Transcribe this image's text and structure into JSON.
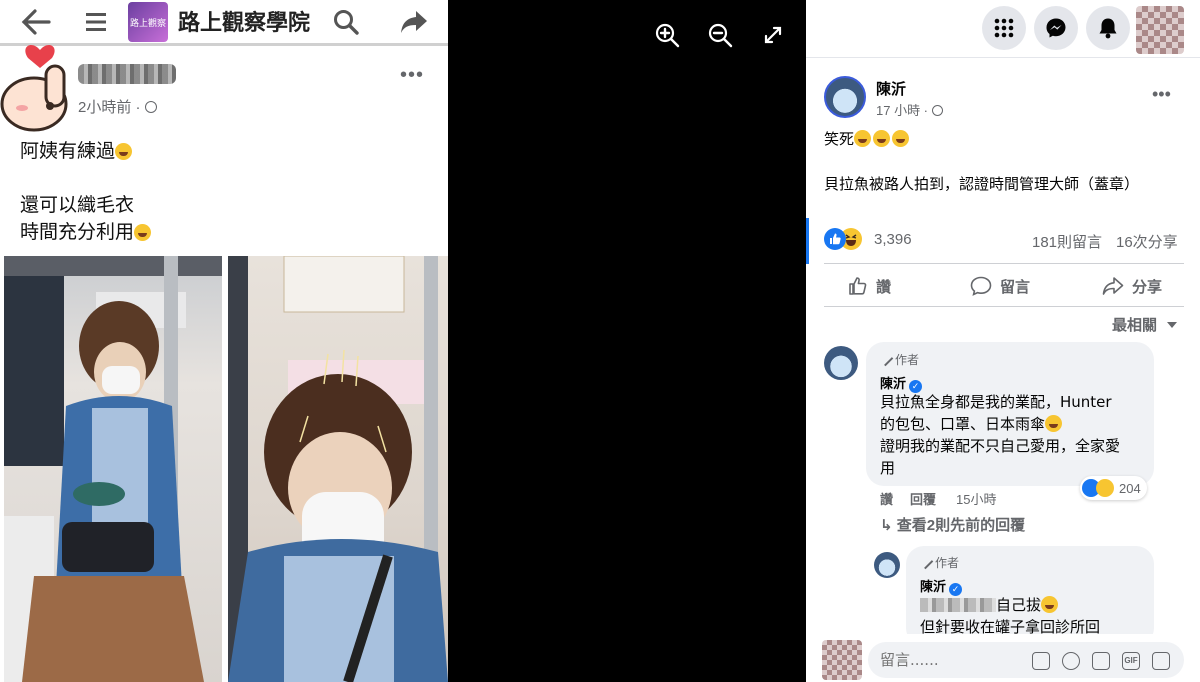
{
  "screenshot": {
    "group_name": "路上觀察學院",
    "group_avatar_text": "路上觀察",
    "post_time": "2小時前 ·",
    "lines": [
      "阿姨有練過",
      "",
      "還可以織毛衣",
      "時間充分利用"
    ]
  },
  "post": {
    "author": "陳沂",
    "time": "17 小時 ·",
    "text_line1": "笑死",
    "text_line2": "貝拉魚被路人拍到，認證時間管理大師（蓋章）",
    "reaction_count": "3,396",
    "comment_count": "181則留言",
    "share_count": "16次分享"
  },
  "actions": {
    "like": "讚",
    "comment": "留言",
    "share": "分享"
  },
  "sort_label": "最相關",
  "comment1": {
    "author_tag": "作者",
    "name": "陳沂",
    "lines": [
      "貝拉魚全身都是我的業配，Hunter",
      "的包包、口罩、日本雨傘",
      "證明我的業配不只自己愛用，全家愛",
      "用"
    ],
    "like": "讚",
    "reply": "回覆",
    "time": "15小時",
    "reaction_count": "204"
  },
  "view_replies": "查看2則先前的回覆",
  "comment2": {
    "author_tag": "作者",
    "name": "陳沂",
    "line1_suffix": "自己拔",
    "line2": "但針要收在罐子拿回診所回"
  },
  "comment_box": {
    "placeholder": "留言......"
  },
  "colors": {
    "accent": "#1877f2",
    "bubble": "#f0f2f5",
    "secondary_text": "#65676b"
  }
}
